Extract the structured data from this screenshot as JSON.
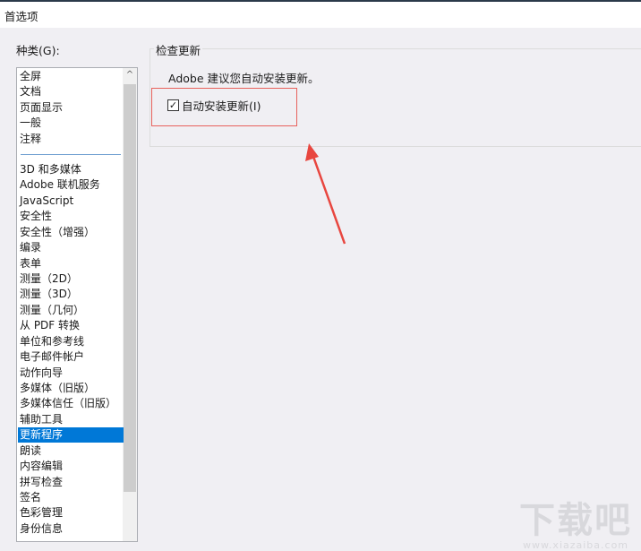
{
  "window": {
    "title": "首选项"
  },
  "categories": {
    "label": "种类(G):",
    "items": [
      "全屏",
      "文档",
      "页面显示",
      "一般",
      "注释"
    ],
    "items2": [
      "3D 和多媒体",
      "Adobe 联机服务",
      "JavaScript",
      "安全性",
      "安全性（增强）",
      "编录",
      "表单",
      "测量（2D）",
      "测量（3D）",
      "测量（几何）",
      "从 PDF 转换",
      "单位和参考线",
      "电子邮件帐户",
      "动作向导",
      "多媒体（旧版）",
      "多媒体信任（旧版）",
      "辅助工具",
      "更新程序",
      "朗读",
      "内容编辑",
      "拼写检查",
      "签名",
      "色彩管理",
      "身份信息"
    ],
    "selected": "更新程序"
  },
  "panel": {
    "group_title": "检查更新",
    "advice": "Adobe 建议您自动安装更新。",
    "checkbox_label": "自动安装更新(I)",
    "checkbox_checked": true
  },
  "annotation": {
    "color": "#e8615c"
  },
  "watermark": {
    "text": "下载吧",
    "url": "www.xiazaiba.com"
  }
}
